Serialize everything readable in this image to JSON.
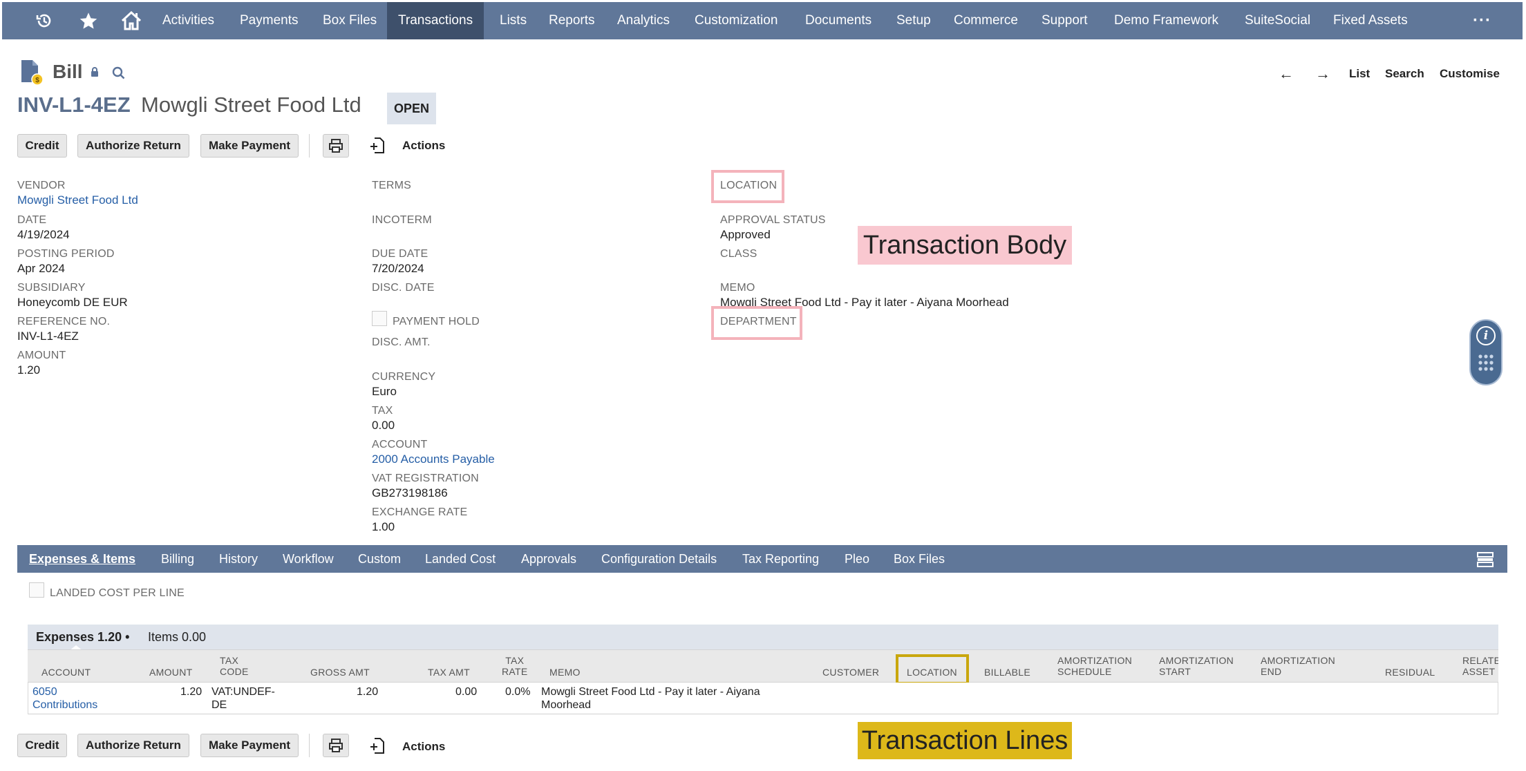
{
  "nav": {
    "icons": [
      "history-icon",
      "star-icon",
      "home-icon"
    ],
    "items": [
      "Activities",
      "Payments",
      "Box Files",
      "Transactions",
      "Lists",
      "Reports",
      "Analytics",
      "Customization",
      "Documents",
      "Setup",
      "Commerce",
      "Support",
      "Demo Framework",
      "SuiteSocial",
      "Fixed Assets"
    ],
    "more": "···",
    "active_index": 3
  },
  "record": {
    "type": "Bill",
    "tranid": "INV-L1-4EZ",
    "entity": "Mowgli Street Food Ltd",
    "status": "OPEN"
  },
  "pager": {
    "list": "List",
    "search": "Search",
    "customise": "Customise"
  },
  "buttons": {
    "credit": "Credit",
    "authorize_return": "Authorize Return",
    "make_payment": "Make Payment",
    "actions": "Actions"
  },
  "fields": {
    "col1": [
      {
        "label": "VENDOR",
        "value": "Mowgli Street Food Ltd",
        "link": true
      },
      {
        "label": "DATE",
        "value": "4/19/2024"
      },
      {
        "label": "POSTING PERIOD",
        "value": "Apr 2024"
      },
      {
        "label": "SUBSIDIARY",
        "value": "Honeycomb DE EUR"
      },
      {
        "label": "REFERENCE NO.",
        "value": "INV-L1-4EZ"
      },
      {
        "label": "AMOUNT",
        "value": "1.20"
      }
    ],
    "col2": {
      "terms": "TERMS",
      "incoterm": "INCOTERM",
      "due_date_label": "DUE DATE",
      "due_date": "7/20/2024",
      "disc_date": "DISC. DATE",
      "payment_hold": "PAYMENT HOLD",
      "disc_amt": "DISC. AMT.",
      "currency_label": "CURRENCY",
      "currency": "Euro",
      "tax_label": "TAX",
      "tax": "0.00",
      "account_label": "ACCOUNT",
      "account": "2000 Accounts Payable",
      "vat_label": "VAT REGISTRATION",
      "vat": "GB273198186",
      "fx_label": "EXCHANGE RATE",
      "fx": "1.00"
    },
    "col3": {
      "location": "LOCATION",
      "approval_label": "APPROVAL STATUS",
      "approval": "Approved",
      "class": "CLASS",
      "memo_label": "MEMO",
      "memo": "Mowgli Street Food Ltd - Pay it later - Aiyana Moorhead",
      "department": "DEPARTMENT"
    }
  },
  "tabs": [
    "Expenses & Items",
    "Billing",
    "History",
    "Workflow",
    "Custom",
    "Landed Cost",
    "Approvals",
    "Configuration Details",
    "Tax Reporting",
    "Pleo",
    "Box Files"
  ],
  "landed_cost_per_line": "LANDED COST PER LINE",
  "sublist": {
    "expenses_tab": "Expenses 1.20 •",
    "items_tab": "Items 0.00",
    "columns": [
      [
        "ACCOUNT"
      ],
      [
        "AMOUNT"
      ],
      [
        "TAX",
        "CODE"
      ],
      [
        "GROSS AMT"
      ],
      [
        "TAX AMT"
      ],
      [
        "TAX",
        "RATE"
      ],
      [
        "MEMO"
      ],
      [
        "CUSTOMER"
      ],
      [
        "LOCATION"
      ],
      [
        "BILLABLE"
      ],
      [
        "AMORTIZATION",
        "SCHEDULE"
      ],
      [
        "AMORTIZATION",
        "START"
      ],
      [
        "AMORTIZATION",
        "END"
      ],
      [
        "RESIDUAL"
      ],
      [
        "RELATE",
        "ASSET"
      ]
    ],
    "row": {
      "account": [
        "6050",
        "Contributions"
      ],
      "amount": "1.20",
      "tax_code": [
        "VAT:UNDEF-",
        "DE"
      ],
      "gross_amt": "1.20",
      "tax_amt": "0.00",
      "tax_rate": "0.0%",
      "memo": [
        "Mowgli Street Food Ltd - Pay it later - Aiyana",
        "Moorhead"
      ]
    }
  },
  "annotations": {
    "body": "Transaction Body",
    "lines": "Transaction Lines"
  },
  "colors": {
    "nav": "#607799",
    "nav_active": "#3e506b",
    "link": "#255ea6",
    "annot_pink": "#f9c8d0",
    "annot_gold": "#ddb81a"
  }
}
